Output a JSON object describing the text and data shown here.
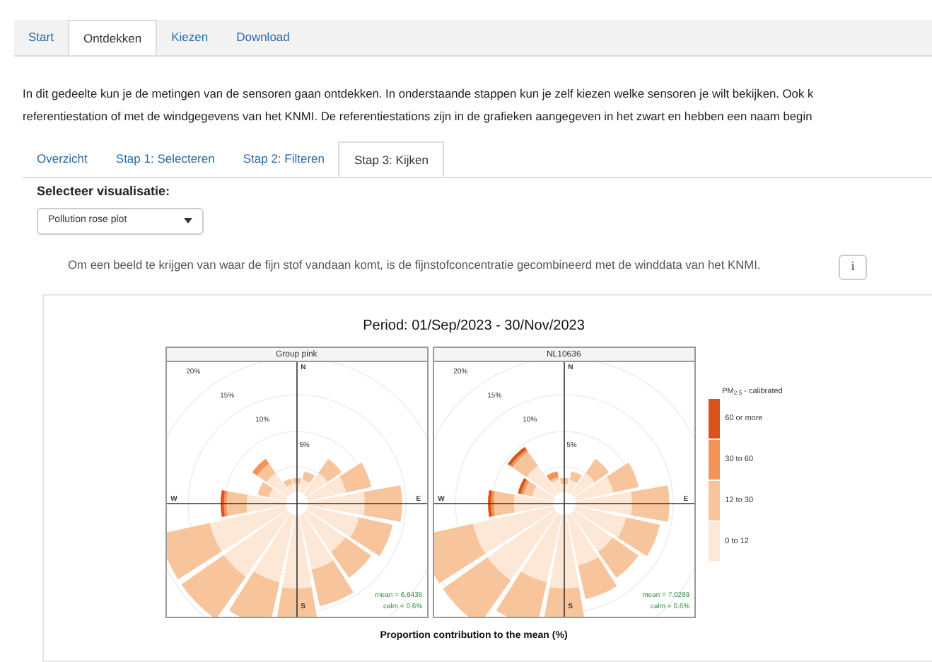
{
  "main_tabs": [
    {
      "label": "Start",
      "selected": false
    },
    {
      "label": "Ontdekken",
      "selected": true
    },
    {
      "label": "Kiezen",
      "selected": false
    },
    {
      "label": "Download",
      "selected": false
    }
  ],
  "intro": [
    "In dit gedeelte kun je de metingen van de sensoren gaan ontdekken. In onderstaande stappen kun je zelf kiezen welke sensoren je wilt bekijken. Ook k",
    "referentiestation of met de windgegevens van het KNMI. De referentiestations zijn in de grafieken aangegeven in het zwart en hebben een naam begin"
  ],
  "step_tabs": [
    {
      "label": "Overzicht",
      "selected": false
    },
    {
      "label": "Stap 1: Selecteren",
      "selected": false
    },
    {
      "label": "Stap 2: Filteren",
      "selected": false
    },
    {
      "label": "Stap 3: Kijken",
      "selected": true
    }
  ],
  "visualisation": {
    "label": "Selecteer visualisatie:",
    "value": "Pollution rose plot"
  },
  "note": "Om een beeld te krijgen van waar de fijn stof vandaan komt, is de fijnstofconcentratie gecombineerd met de winddata van het KNMI.",
  "info_button": "i",
  "plot": {
    "title": "Period: 01/Sep/2023 - 30/Nov/2023",
    "panels": [
      {
        "title": "Group pink",
        "ring_labels": [
          "20%",
          "15%",
          "10%",
          "5%"
        ],
        "directions": [
          "N",
          "E",
          "S",
          "W"
        ],
        "mean": "mean = 6.6435",
        "calm": "calm = 0.6%"
      },
      {
        "title": "NL10636",
        "ring_labels": [
          "20%",
          "15%",
          "10%",
          "5%"
        ],
        "directions": [
          "N",
          "E",
          "S",
          "W"
        ],
        "mean": "mean = 7.0289",
        "calm": "calm = 0.6%"
      }
    ],
    "legend_title": "PM$_{2.5}$ - calibrated",
    "legend": [
      {
        "label": "60 or more",
        "color": "#d9531e"
      },
      {
        "label": "30 to 60",
        "color": "#f0945a"
      },
      {
        "label": "12 to 30",
        "color": "#f8c49c"
      },
      {
        "label": "0 to 12",
        "color": "#fde8d8"
      }
    ],
    "xlabel": "Proportion contribution to the mean (%)"
  }
}
